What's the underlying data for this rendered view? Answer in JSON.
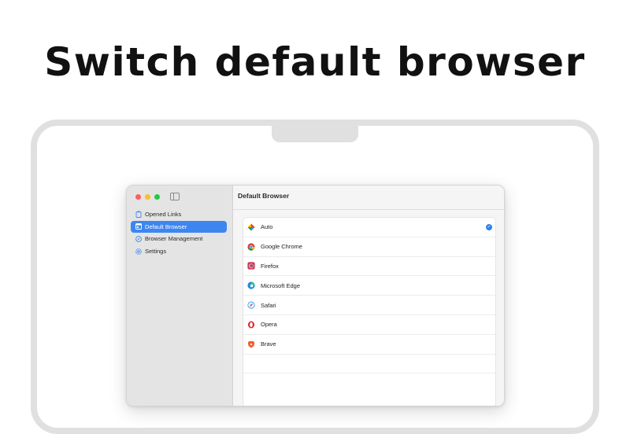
{
  "headline": "Switch default browser",
  "window": {
    "sidebar": {
      "items": [
        {
          "label": "Opened Links",
          "icon": "clipboard-icon",
          "selected": false
        },
        {
          "label": "Default Browser",
          "icon": "browser-window-icon",
          "selected": true
        },
        {
          "label": "Browser Management",
          "icon": "compass-icon",
          "selected": false
        },
        {
          "label": "Settings",
          "icon": "gear-icon",
          "selected": false
        }
      ]
    },
    "main": {
      "title": "Default Browser",
      "browsers": [
        {
          "label": "Auto",
          "icon": "auto-icon",
          "checked": true
        },
        {
          "label": "Google Chrome",
          "icon": "chrome-icon",
          "checked": false
        },
        {
          "label": "Firefox",
          "icon": "firefox-icon",
          "checked": false
        },
        {
          "label": "Microsoft Edge",
          "icon": "edge-icon",
          "checked": false
        },
        {
          "label": "Safari",
          "icon": "safari-icon",
          "checked": false
        },
        {
          "label": "Opera",
          "icon": "opera-icon",
          "checked": false
        },
        {
          "label": "Brave",
          "icon": "brave-icon",
          "checked": false
        }
      ]
    }
  },
  "colors": {
    "accent": "#3d86f0",
    "traffic_close": "#fe5f57",
    "traffic_min": "#febc2e",
    "traffic_max": "#28c840"
  }
}
